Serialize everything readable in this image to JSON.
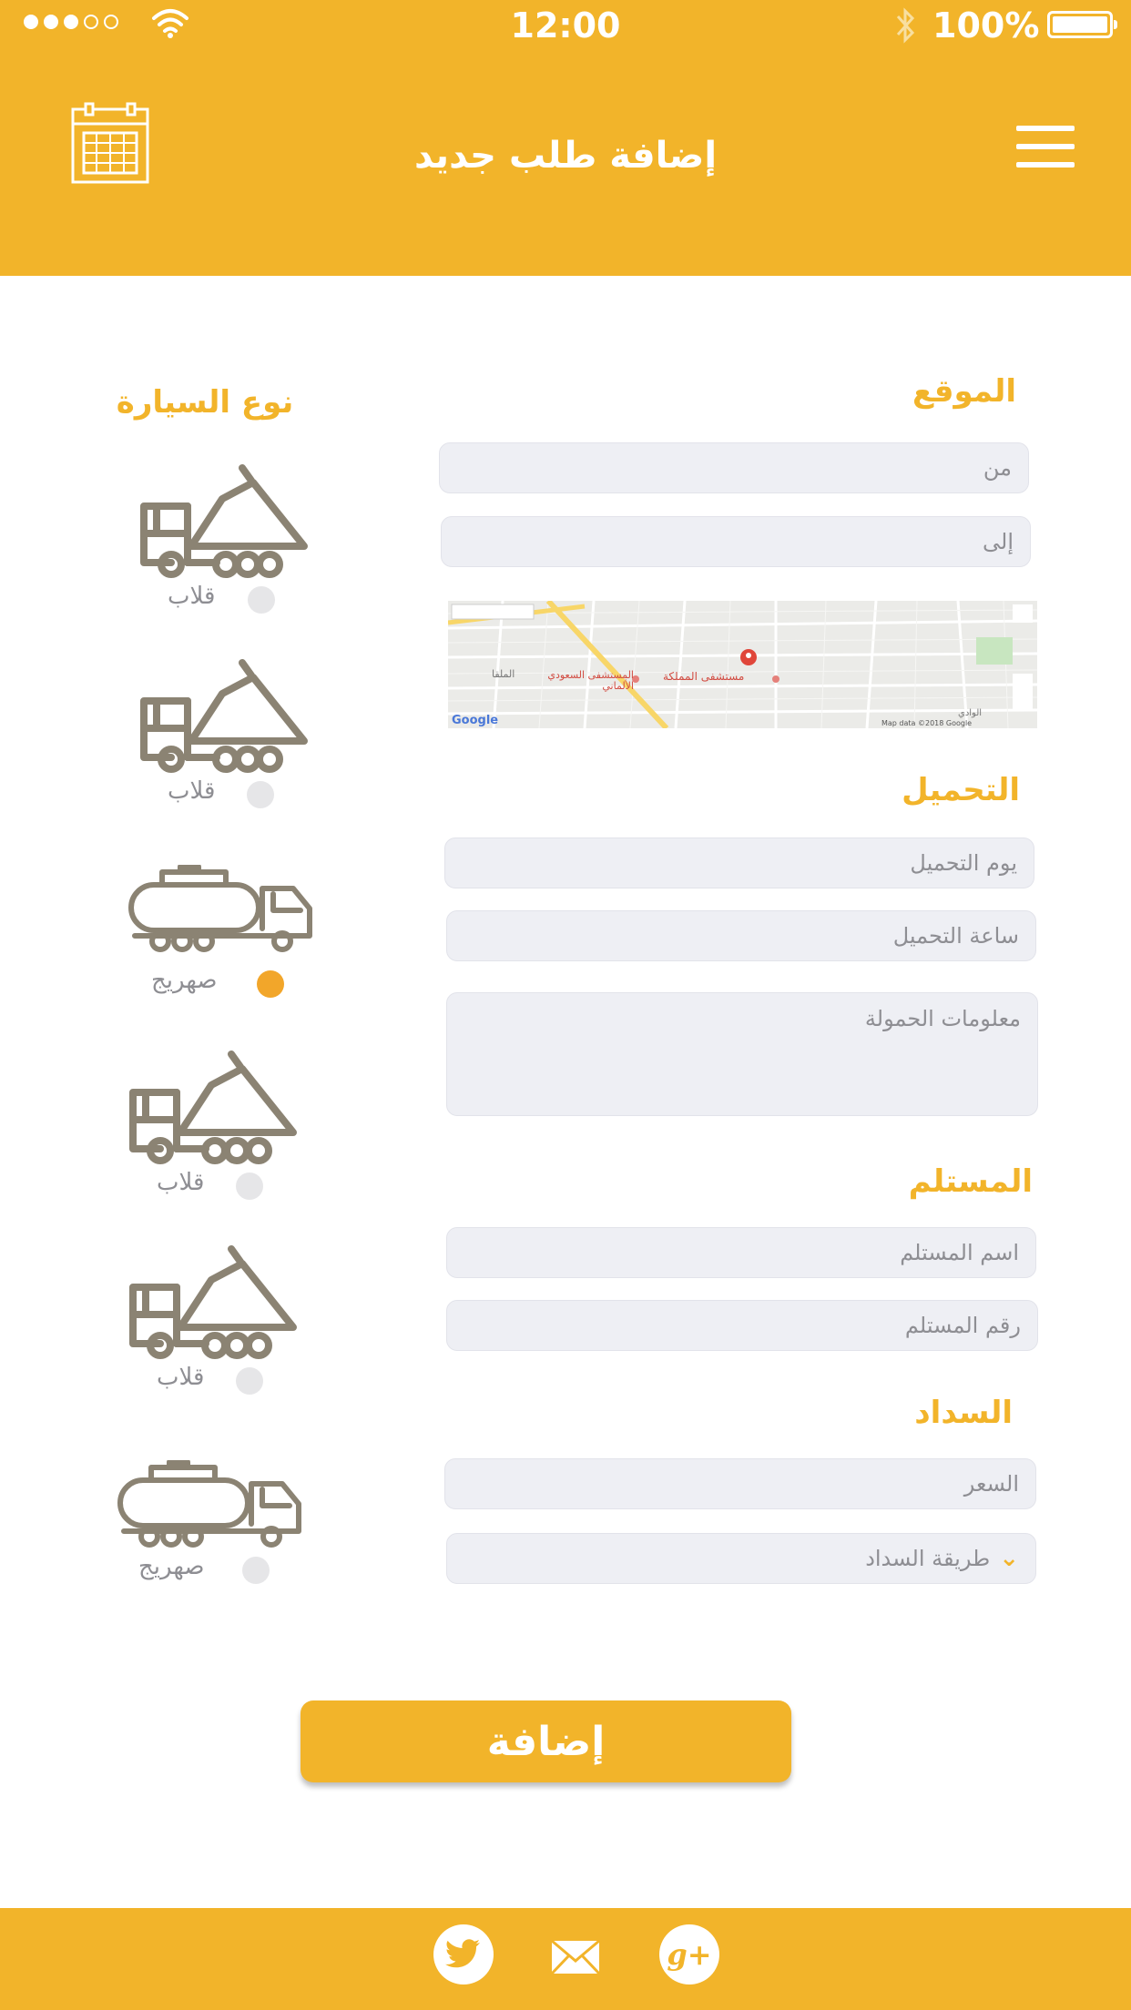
{
  "status_bar": {
    "time": "12:00",
    "battery": "100%"
  },
  "header": {
    "title": "إضافة طلب جديد"
  },
  "vehicle_type": {
    "title": "نوع السيارة",
    "options": [
      {
        "label": "قلاب",
        "icon": "dump-truck-icon",
        "selected": false
      },
      {
        "label": "قلاب",
        "icon": "dump-truck-icon",
        "selected": false
      },
      {
        "label": "صهريج",
        "icon": "tanker-truck-icon",
        "selected": true
      },
      {
        "label": "قلاب",
        "icon": "dump-truck-icon",
        "selected": false
      },
      {
        "label": "قلاب",
        "icon": "dump-truck-icon",
        "selected": false
      },
      {
        "label": "صهريج",
        "icon": "tanker-truck-icon",
        "selected": false
      }
    ]
  },
  "location": {
    "title": "الموقع",
    "from_placeholder": "من",
    "to_placeholder": "إلى",
    "map": {
      "label_hospital": "مستشفى المملكة",
      "label_hospital2": "المستشفى السعودي الألماني",
      "label_area": "الملقا",
      "label_area2": "الوادي",
      "google": "Google",
      "credit": "Map data ©2018 Google"
    }
  },
  "loading": {
    "title": "التحميل",
    "day_placeholder": "يوم التحميل",
    "hour_placeholder": "ساعة التحميل",
    "info_placeholder": "معلومات الحمولة"
  },
  "receiver": {
    "title": "المستلم",
    "name_placeholder": "اسم المستلم",
    "number_placeholder": "رقم  المستلم"
  },
  "payment": {
    "title": "السداد",
    "price_placeholder": "السعر",
    "method_placeholder": "طريقة السداد"
  },
  "actions": {
    "add_label": "إضافة"
  },
  "footer": {
    "icons": [
      "twitter-icon",
      "mail-icon",
      "google-plus-icon"
    ]
  },
  "colors": {
    "accent": "#f2b42a",
    "selected_radio": "#f2a62a",
    "field_bg": "#eeeff4",
    "truck": "#8b8373"
  }
}
